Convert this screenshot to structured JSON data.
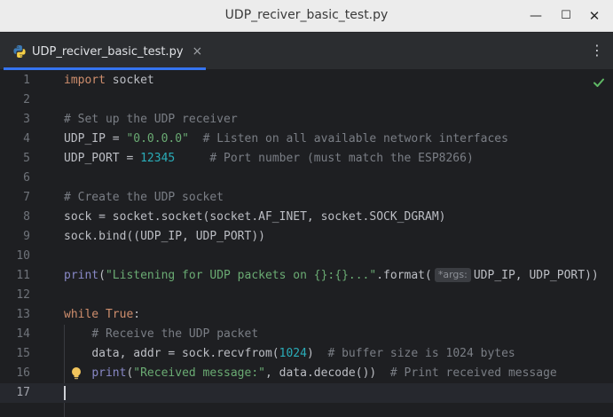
{
  "window": {
    "title": "UDP_reciver_basic_test.py",
    "minimize_label": "—",
    "maximize_label": "☐",
    "close_label": "✕"
  },
  "tabs": [
    {
      "label": "UDP_reciver_basic_test.py",
      "icon": "python-icon",
      "close_label": "×",
      "active": true
    }
  ],
  "tab_menu_label": "⋮",
  "colors": {
    "accent": "#3574f0",
    "keyword": "#cf8e6d",
    "string": "#6aab73",
    "number": "#2aacb8",
    "comment": "#7a7e85",
    "builtin": "#8888c6",
    "check": "#5fb865",
    "bulb": "#f2c55c"
  },
  "editor": {
    "inspection_status": "check-icon",
    "current_line": 17,
    "lines": [
      {
        "n": "1",
        "t": {
          "kw": "import",
          "rest": " socket"
        }
      },
      {
        "n": "2"
      },
      {
        "n": "3",
        "t": {
          "cmt": "# Set up the UDP receiver"
        }
      },
      {
        "n": "4",
        "t": {
          "a": "UDP_IP = ",
          "str": "\"0.0.0.0\"",
          "sp": "  ",
          "cmt": "# Listen on all available network interfaces"
        }
      },
      {
        "n": "5",
        "t": {
          "a": "UDP_PORT = ",
          "num": "12345",
          "sp": "     ",
          "cmt": "# Port number (must match the ESP8266)"
        }
      },
      {
        "n": "6"
      },
      {
        "n": "7",
        "t": {
          "cmt": "# Create the UDP socket"
        }
      },
      {
        "n": "8",
        "t": {
          "a": "sock = socket.socket(socket.AF_INET, socket.SOCK_DGRAM)"
        }
      },
      {
        "n": "9",
        "t": {
          "a": "sock.bind((UDP_IP, UDP_PORT))"
        }
      },
      {
        "n": "10"
      },
      {
        "n": "11",
        "t": {
          "bi": "print",
          "a": "(",
          "str": "\"Listening for UDP packets on {}:{}...\"",
          "b": ".format(",
          "hint": "*args:",
          "c": "UDP_IP, UDP_PORT))"
        }
      },
      {
        "n": "12"
      },
      {
        "n": "13",
        "t": {
          "kw": "while",
          "sp": " ",
          "kw2": "True",
          "a": ":"
        }
      },
      {
        "n": "14",
        "t": {
          "ind": "    ",
          "cmt": "# Receive the UDP packet"
        }
      },
      {
        "n": "15",
        "t": {
          "ind": "    ",
          "a": "data, addr = sock.recvfrom(",
          "num": "1024",
          "b": ")  ",
          "cmt": "# buffer size is 1024 bytes"
        }
      },
      {
        "n": "16",
        "t": {
          "ind": "    ",
          "bi": "print",
          "a": "(",
          "str": "\"Received message:\"",
          "b": ", data.decode())  ",
          "cmt": "# Print received message"
        }
      },
      {
        "n": "17"
      }
    ]
  }
}
